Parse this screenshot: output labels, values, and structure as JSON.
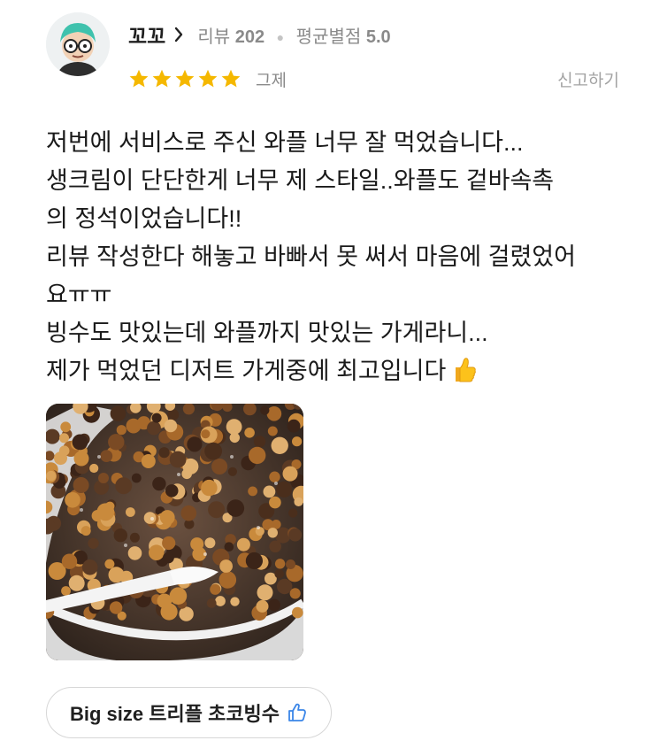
{
  "reviewer": {
    "nickname": "꼬꼬",
    "review_count_label": "리뷰",
    "review_count": "202",
    "avg_rating_label": "평균별점",
    "avg_rating": "5.0",
    "avatar": "glasses-character-avatar"
  },
  "review": {
    "stars": 5,
    "rating_caption": "그제",
    "report_label": "신고하기",
    "lines": [
      "저번에 서비스로 주신 와플 너무 잘 먹었습니다...",
      "생크림이 단단한게 너무 제 스타일..와플도 겉바속촉",
      "의 정석이었습니다!!",
      "리뷰 작성한다 해놓고 바빠서 못 써서 마음에 걸렸었어",
      "요ㅠㅠ",
      "빙수도 맛있는데 와플까지 맛있는 가게라니...",
      "제가 먹었던 디저트 가게중에 최고입니다"
    ],
    "end_emoji": "thumbs-up-emoji",
    "photo": "chocolate-bingsu-photo"
  },
  "menu_chip": {
    "label": "Big size 트리플 초코빙수",
    "icon": "thumbs-up-outline-icon"
  },
  "colors": {
    "star": "#f5b800",
    "muted_text": "#8a8a8a",
    "chip_border": "#d7d7d7",
    "like_icon": "#3b86e8"
  }
}
